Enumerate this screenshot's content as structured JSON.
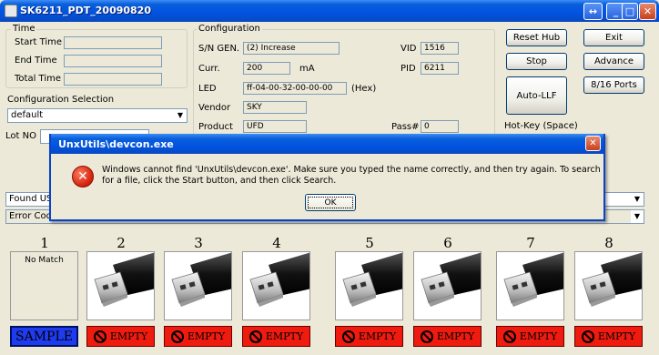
{
  "window": {
    "title": "SK6211_PDT_20090820",
    "controls": {
      "restore": "↔",
      "minimize": "_",
      "maximize": "□",
      "close": "✕"
    }
  },
  "time": {
    "group_label": "Time",
    "start_label": "Start Time",
    "end_label": "End Time",
    "total_label": "Total Time",
    "start_value": "",
    "end_value": "",
    "total_value": ""
  },
  "config_selection": {
    "label": "Configuration Selection",
    "value": "default"
  },
  "lot": {
    "label": "Lot NO",
    "value": ""
  },
  "found_usb": {
    "label": "Found USB D",
    "value": ""
  },
  "error_code": {
    "label": "Error Code D",
    "value": ""
  },
  "configuration": {
    "group_label": "Configuration",
    "sn_label": "S/N GEN.",
    "sn_value": "(2) Increase",
    "curr_label": "Curr.",
    "curr_value": "200",
    "curr_unit": "mA",
    "led_label": "LED",
    "led_value": "ff-04-00-32-00-00-00",
    "led_unit": "(Hex)",
    "vendor_label": "Vendor",
    "vendor_value": "SKY",
    "product_label": "Product",
    "product_value": "UFD",
    "vid_label": "VID",
    "vid_value": "1516",
    "pid_label": "PID",
    "pid_value": "6211",
    "pass_label": "Pass#",
    "pass_value": "0"
  },
  "buttons": {
    "reset_hub": "Reset Hub",
    "exit": "Exit",
    "stop": "Stop",
    "advance": "Advance",
    "auto_llf": "Auto-LLF",
    "ports": "8/16 Ports",
    "hotkey": "Hot-Key (Space)"
  },
  "dialog": {
    "title": "UnxUtils\\devcon.exe",
    "message": "Windows cannot find 'UnxUtils\\devcon.exe'. Make sure you typed the name correctly, and then try again. To search for a file, click the Start button, and then click Search.",
    "ok": "OK",
    "icon": "error-icon",
    "close": "✕"
  },
  "ports": [
    {
      "num": "1",
      "box_text": "No Match",
      "status": "SAMPLE"
    },
    {
      "num": "2",
      "status": "EMPTY"
    },
    {
      "num": "3",
      "status": "EMPTY"
    },
    {
      "num": "4",
      "status": "EMPTY"
    },
    {
      "num": "5",
      "status": "EMPTY"
    },
    {
      "num": "6",
      "status": "EMPTY"
    },
    {
      "num": "7",
      "status": "EMPTY"
    },
    {
      "num": "8",
      "status": "EMPTY"
    }
  ],
  "colors": {
    "titlebar": "#0054e3",
    "empty_status": "#ee1b0e",
    "sample_status": "#1f3bf0",
    "window_bg": "#ece9d8"
  }
}
